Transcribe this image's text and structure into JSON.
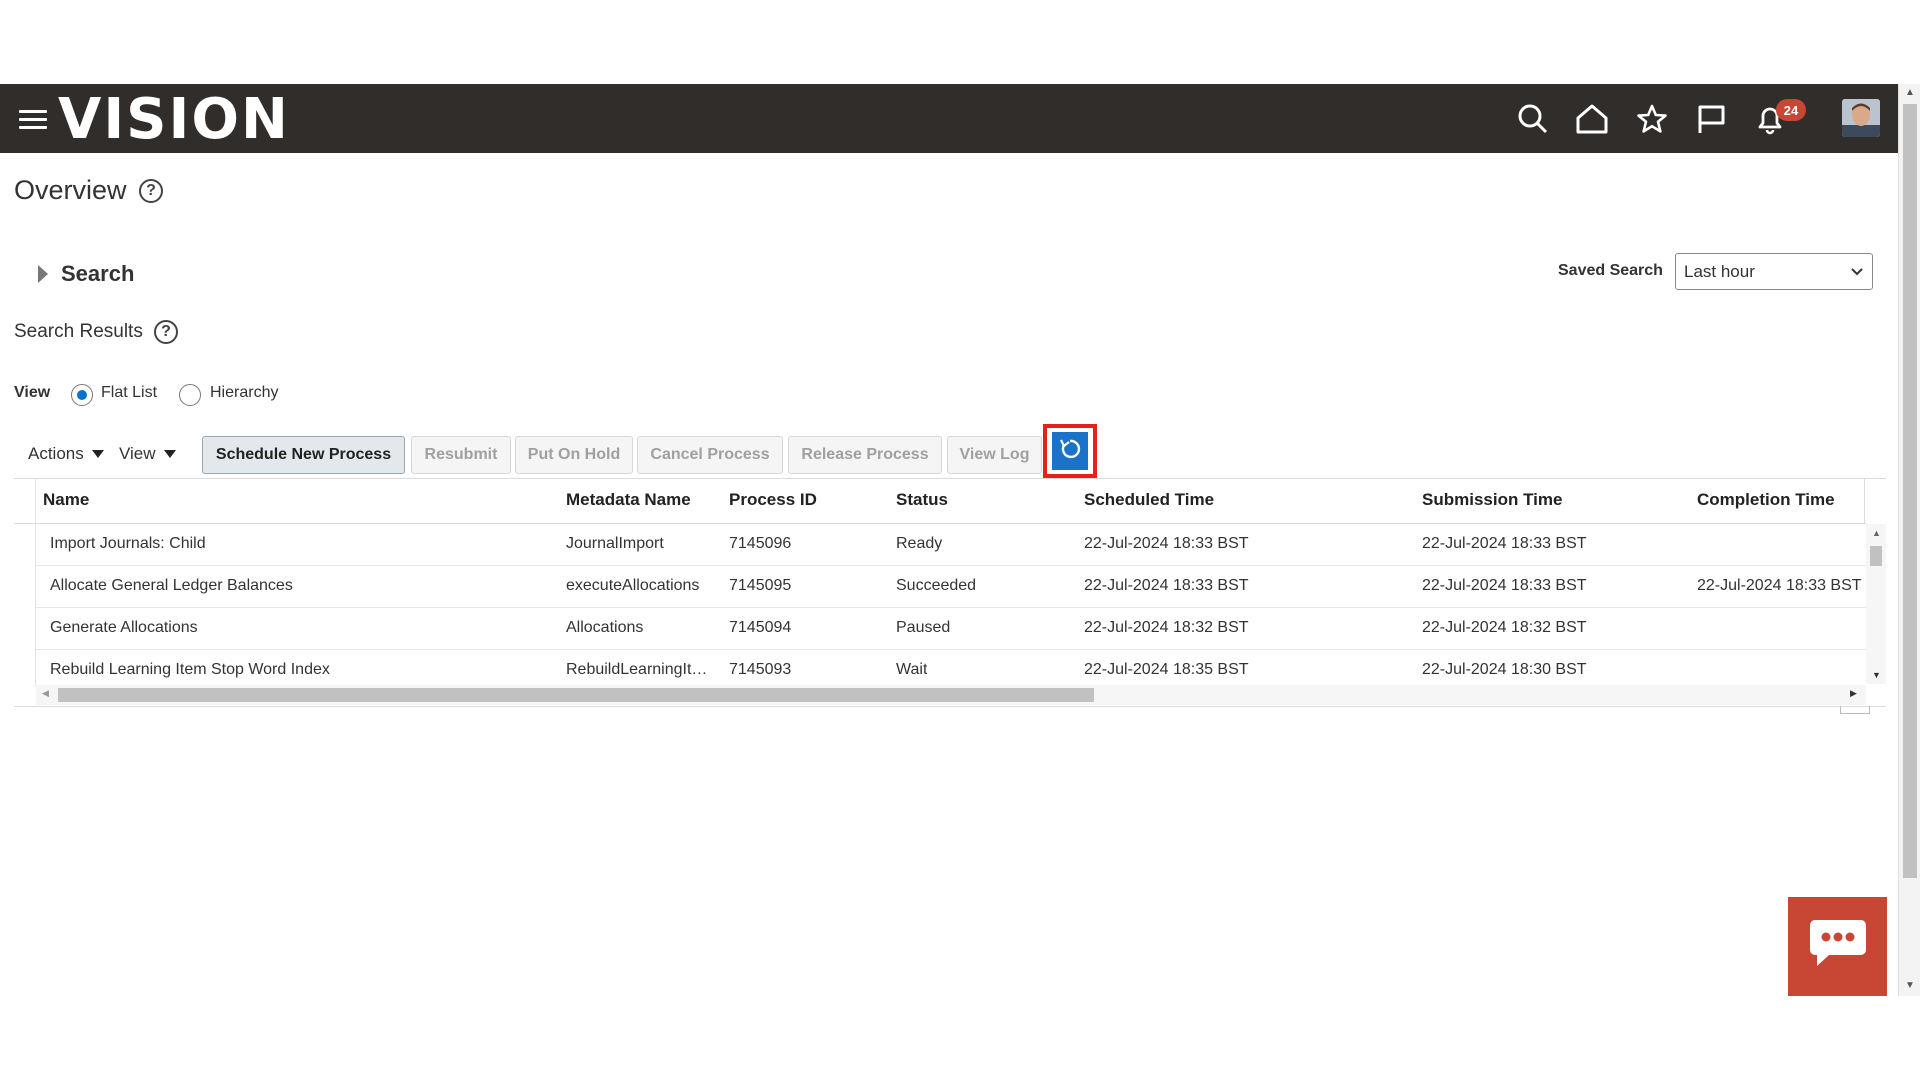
{
  "header": {
    "logo_text": "VISION",
    "notification_count": "24",
    "icons": [
      "menu-icon",
      "search-icon",
      "home-icon",
      "star-icon",
      "flag-icon",
      "bell-icon"
    ]
  },
  "page": {
    "title": "Overview"
  },
  "search": {
    "label": "Search",
    "saved_search_label": "Saved Search",
    "saved_search_value": "Last hour"
  },
  "results": {
    "label": "Search Results",
    "view_label": "View",
    "view_options": [
      "Flat List",
      "Hierarchy"
    ],
    "selected_view": "Flat List"
  },
  "toolbar": {
    "actions_label": "Actions",
    "view_label": "View",
    "buttons": {
      "schedule": "Schedule New Process",
      "resubmit": "Resubmit",
      "hold": "Put On Hold",
      "cancel": "Cancel Process",
      "release": "Release Process",
      "viewlog": "View Log"
    }
  },
  "table": {
    "columns": [
      "Name",
      "Metadata Name",
      "Process ID",
      "Status",
      "Scheduled Time",
      "Submission Time",
      "Completion Time"
    ],
    "rows": [
      [
        "Import Journals: Child",
        "JournalImport",
        "7145096",
        "Ready",
        "22-Jul-2024 18:33 BST",
        "22-Jul-2024 18:33 BST",
        ""
      ],
      [
        "Allocate General Ledger Balances",
        "executeAllocations",
        "7145095",
        "Succeeded",
        "22-Jul-2024 18:33 BST",
        "22-Jul-2024 18:33 BST",
        "22-Jul-2024 18:33 BST"
      ],
      [
        "Generate Allocations",
        "Allocations",
        "7145094",
        "Paused",
        "22-Jul-2024 18:32 BST",
        "22-Jul-2024 18:32 BST",
        ""
      ],
      [
        "Rebuild Learning Item Stop Word Index",
        "RebuildLearningIt…",
        "7145093",
        "Wait",
        "22-Jul-2024 18:35 BST",
        "22-Jul-2024 18:30 BST",
        ""
      ]
    ]
  },
  "colors": {
    "header_bg": "#312d2a",
    "accent": "#c74634",
    "highlight": "#e5211b",
    "refresh_bg": "#1a73c9"
  }
}
